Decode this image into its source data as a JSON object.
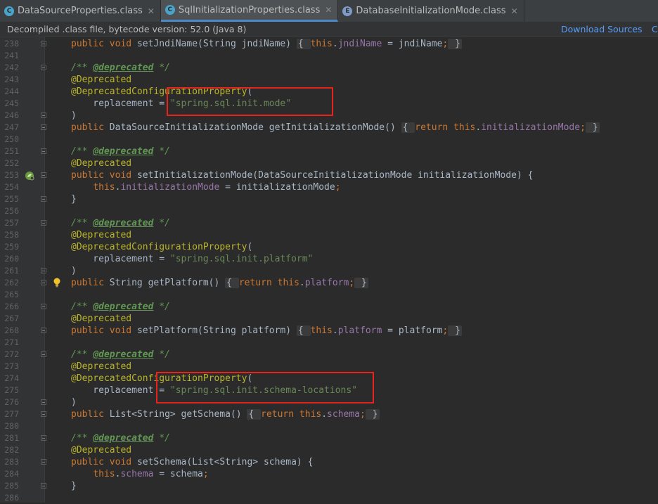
{
  "tabs": [
    {
      "label": "DataSourceProperties.class",
      "icon": "class-icon",
      "active": false
    },
    {
      "label": "SqlInitializationProperties.class",
      "icon": "class-icon",
      "active": true
    },
    {
      "label": "DatabaseInitializationMode.class",
      "icon": "enum-icon",
      "active": false
    }
  ],
  "notice": {
    "message": "Decompiled .class file, bytecode version: 52.0 (Java 8)",
    "download_sources": "Download Sources",
    "choose_sources": "C"
  },
  "lines": [
    {
      "num": "238",
      "tokens": [
        [
          "kw",
          "public "
        ],
        [
          "kw",
          "void "
        ],
        [
          "plain",
          "setJndiName(String jndiName) "
        ],
        [
          "fb",
          "{ "
        ],
        [
          "kw",
          "this"
        ],
        [
          "plain",
          "."
        ],
        [
          "fld",
          "jndiName"
        ],
        [
          "plain",
          " = jndiName"
        ],
        [
          "kw",
          ";"
        ],
        [
          "fb",
          " }"
        ]
      ]
    },
    {
      "num": "241",
      "tokens": []
    },
    {
      "num": "242",
      "tokens": [
        [
          "cmt",
          "/** "
        ],
        [
          "tag",
          "@deprecated"
        ],
        [
          "cmt",
          " */"
        ]
      ]
    },
    {
      "num": "243",
      "tokens": [
        [
          "ann",
          "@Deprecated"
        ]
      ]
    },
    {
      "num": "244",
      "tokens": [
        [
          "ann",
          "@DeprecatedConfigurationProperty"
        ],
        [
          "plain",
          "("
        ]
      ]
    },
    {
      "num": "245",
      "tokens": [
        [
          "plain",
          "    replacement = "
        ],
        [
          "str",
          "\"spring.sql.init.mode\""
        ]
      ]
    },
    {
      "num": "246",
      "tokens": [
        [
          "plain",
          ")"
        ]
      ]
    },
    {
      "num": "247",
      "tokens": [
        [
          "kw",
          "public "
        ],
        [
          "plain",
          "DataSourceInitializationMode getInitializationMode() "
        ],
        [
          "fb",
          "{ "
        ],
        [
          "kw",
          "return this"
        ],
        [
          "plain",
          "."
        ],
        [
          "fld",
          "initializationMode"
        ],
        [
          "kw",
          ";"
        ],
        [
          "fb",
          " }"
        ]
      ]
    },
    {
      "num": "250",
      "tokens": []
    },
    {
      "num": "251",
      "tokens": [
        [
          "cmt",
          "/** "
        ],
        [
          "tag",
          "@deprecated"
        ],
        [
          "cmt",
          " */"
        ]
      ]
    },
    {
      "num": "252",
      "tokens": [
        [
          "ann",
          "@Deprecated"
        ]
      ]
    },
    {
      "num": "253",
      "tokens": [
        [
          "kw",
          "public "
        ],
        [
          "kw",
          "void "
        ],
        [
          "plain",
          "setInitializationMode(DataSourceInitializationMode initializationMode) {"
        ]
      ]
    },
    {
      "num": "254",
      "tokens": [
        [
          "plain",
          "    "
        ],
        [
          "kw",
          "this"
        ],
        [
          "plain",
          "."
        ],
        [
          "fld",
          "initializationMode"
        ],
        [
          "plain",
          " = initializationMode"
        ],
        [
          "kw",
          ";"
        ]
      ]
    },
    {
      "num": "255",
      "tokens": [
        [
          "plain",
          "}"
        ]
      ]
    },
    {
      "num": "256",
      "tokens": []
    },
    {
      "num": "257",
      "tokens": [
        [
          "cmt",
          "/** "
        ],
        [
          "tag",
          "@deprecated"
        ],
        [
          "cmt",
          " */"
        ]
      ]
    },
    {
      "num": "258",
      "tokens": [
        [
          "ann",
          "@Deprecated"
        ]
      ]
    },
    {
      "num": "259",
      "tokens": [
        [
          "ann",
          "@DeprecatedConfigurationProperty"
        ],
        [
          "plain",
          "("
        ]
      ]
    },
    {
      "num": "260",
      "tokens": [
        [
          "plain",
          "    replacement = "
        ],
        [
          "str",
          "\"spring.sql.init.platform\""
        ]
      ]
    },
    {
      "num": "261",
      "tokens": [
        [
          "plain",
          ")"
        ]
      ]
    },
    {
      "num": "262",
      "tokens": [
        [
          "kw",
          "public "
        ],
        [
          "plain",
          "String getPlatform() "
        ],
        [
          "fb",
          "{ "
        ],
        [
          "kw",
          "return this"
        ],
        [
          "plain",
          "."
        ],
        [
          "fld",
          "platform"
        ],
        [
          "kw",
          ";"
        ],
        [
          "fb",
          " }"
        ]
      ]
    },
    {
      "num": "265",
      "tokens": []
    },
    {
      "num": "266",
      "tokens": [
        [
          "cmt",
          "/** "
        ],
        [
          "tag",
          "@deprecated"
        ],
        [
          "cmt",
          " */"
        ]
      ]
    },
    {
      "num": "267",
      "tokens": [
        [
          "ann",
          "@Deprecated"
        ]
      ]
    },
    {
      "num": "268",
      "tokens": [
        [
          "kw",
          "public "
        ],
        [
          "kw",
          "void "
        ],
        [
          "plain",
          "setPlatform(String platform) "
        ],
        [
          "fb",
          "{ "
        ],
        [
          "kw",
          "this"
        ],
        [
          "plain",
          "."
        ],
        [
          "fld",
          "platform"
        ],
        [
          "plain",
          " = platform"
        ],
        [
          "kw",
          ";"
        ],
        [
          "fb",
          " }"
        ]
      ]
    },
    {
      "num": "271",
      "tokens": []
    },
    {
      "num": "272",
      "tokens": [
        [
          "cmt",
          "/** "
        ],
        [
          "tag",
          "@deprecated"
        ],
        [
          "cmt",
          " */"
        ]
      ]
    },
    {
      "num": "273",
      "tokens": [
        [
          "ann",
          "@Deprecated"
        ]
      ]
    },
    {
      "num": "274",
      "tokens": [
        [
          "ann",
          "@DeprecatedConfigurationProperty"
        ],
        [
          "plain",
          "("
        ]
      ]
    },
    {
      "num": "275",
      "tokens": [
        [
          "plain",
          "    replacement = "
        ],
        [
          "str",
          "\"spring.sql.init.schema-locations\""
        ]
      ]
    },
    {
      "num": "276",
      "tokens": [
        [
          "plain",
          ")"
        ]
      ]
    },
    {
      "num": "277",
      "tokens": [
        [
          "kw",
          "public "
        ],
        [
          "plain",
          "List<String> getSchema() "
        ],
        [
          "fb",
          "{ "
        ],
        [
          "kw",
          "return this"
        ],
        [
          "plain",
          "."
        ],
        [
          "fld",
          "schema"
        ],
        [
          "kw",
          ";"
        ],
        [
          "fb",
          " }"
        ]
      ]
    },
    {
      "num": "280",
      "tokens": []
    },
    {
      "num": "281",
      "tokens": [
        [
          "cmt",
          "/** "
        ],
        [
          "tag",
          "@deprecated"
        ],
        [
          "cmt",
          " */"
        ]
      ]
    },
    {
      "num": "282",
      "tokens": [
        [
          "ann",
          "@Deprecated"
        ]
      ]
    },
    {
      "num": "283",
      "tokens": [
        [
          "kw",
          "public "
        ],
        [
          "kw",
          "void "
        ],
        [
          "plain",
          "setSchema(List<String> schema) {"
        ]
      ]
    },
    {
      "num": "284",
      "tokens": [
        [
          "plain",
          "    "
        ],
        [
          "kw",
          "this"
        ],
        [
          "plain",
          "."
        ],
        [
          "fld",
          "schema"
        ],
        [
          "plain",
          " = schema"
        ],
        [
          "kw",
          ";"
        ]
      ]
    },
    {
      "num": "285",
      "tokens": [
        [
          "plain",
          "}"
        ]
      ]
    },
    {
      "num": "286",
      "tokens": []
    }
  ],
  "gutter_markers": {
    "spring_bean_line": "253",
    "intention_bulb_line": "262"
  },
  "highlight_color": "#e8231c"
}
